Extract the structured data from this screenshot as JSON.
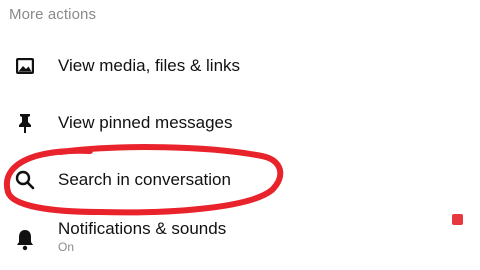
{
  "section": {
    "title": "More actions"
  },
  "items": [
    {
      "label": "View media, files & links",
      "icon": "image-icon"
    },
    {
      "label": "View pinned messages",
      "icon": "pin-icon"
    },
    {
      "label": "Search in conversation",
      "icon": "search-icon"
    },
    {
      "label": "Notifications & sounds",
      "sublabel": "On",
      "icon": "bell-icon"
    }
  ],
  "annotation": {
    "color": "#e8232b"
  },
  "indicator": {
    "color": "#e8383f"
  }
}
